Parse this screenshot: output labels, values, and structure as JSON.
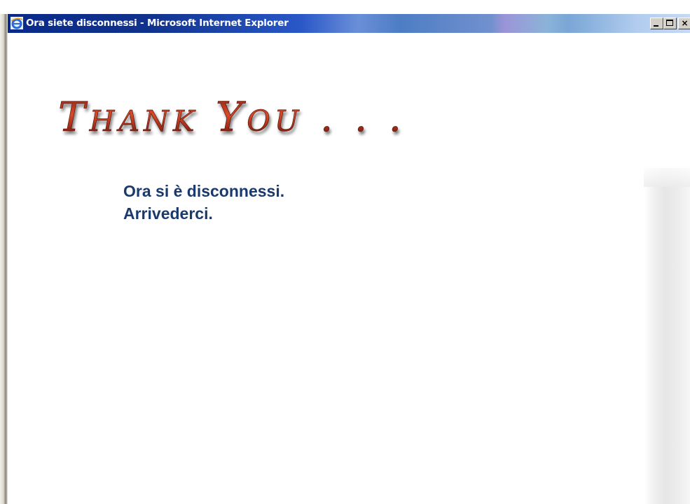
{
  "window": {
    "title": "Ora siete disconnessi - Microsoft Internet Explorer",
    "icon": "internet-explorer-icon",
    "controls": {
      "minimize_icon": "minimize-icon",
      "maximize_icon": "maximize-icon",
      "close_label": "×"
    }
  },
  "page": {
    "heading": "Thank You . . .",
    "message_line1": "Ora si è disconnessi.",
    "message_line2": "Arrivederci."
  },
  "colors": {
    "heading_dark": "#6e1208",
    "heading_light": "#d84a2a",
    "message_text": "#1a3a6e",
    "titlebar_dark": "#0a2a8a"
  }
}
